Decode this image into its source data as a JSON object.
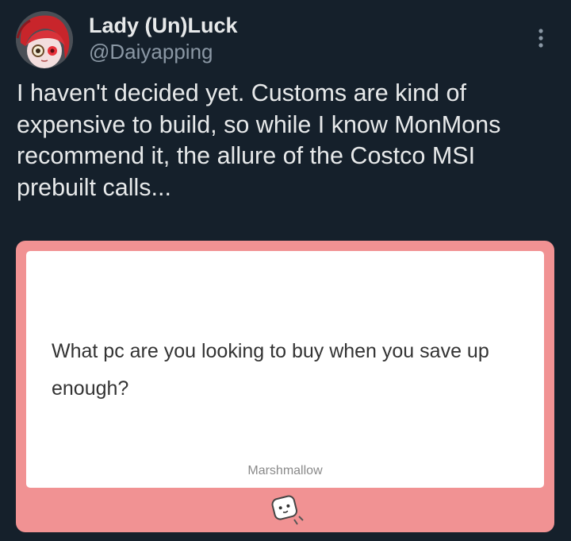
{
  "author": {
    "display_name": "Lady (Un)Luck",
    "handle": "@Daiyapping"
  },
  "tweet": {
    "text": "I haven't decided yet. Customs are kind of\nexpensive to build, so while I know MonMons\nrecommend it, the allure of the Costco MSI\nprebuilt calls..."
  },
  "card": {
    "question": "What pc are you looking to buy when you save up enough?",
    "brand": "Marshmallow",
    "background_color": "#f19293"
  },
  "icons": {
    "more": "more-vertical-icon",
    "mascot": "marshmallow-mascot-icon"
  }
}
